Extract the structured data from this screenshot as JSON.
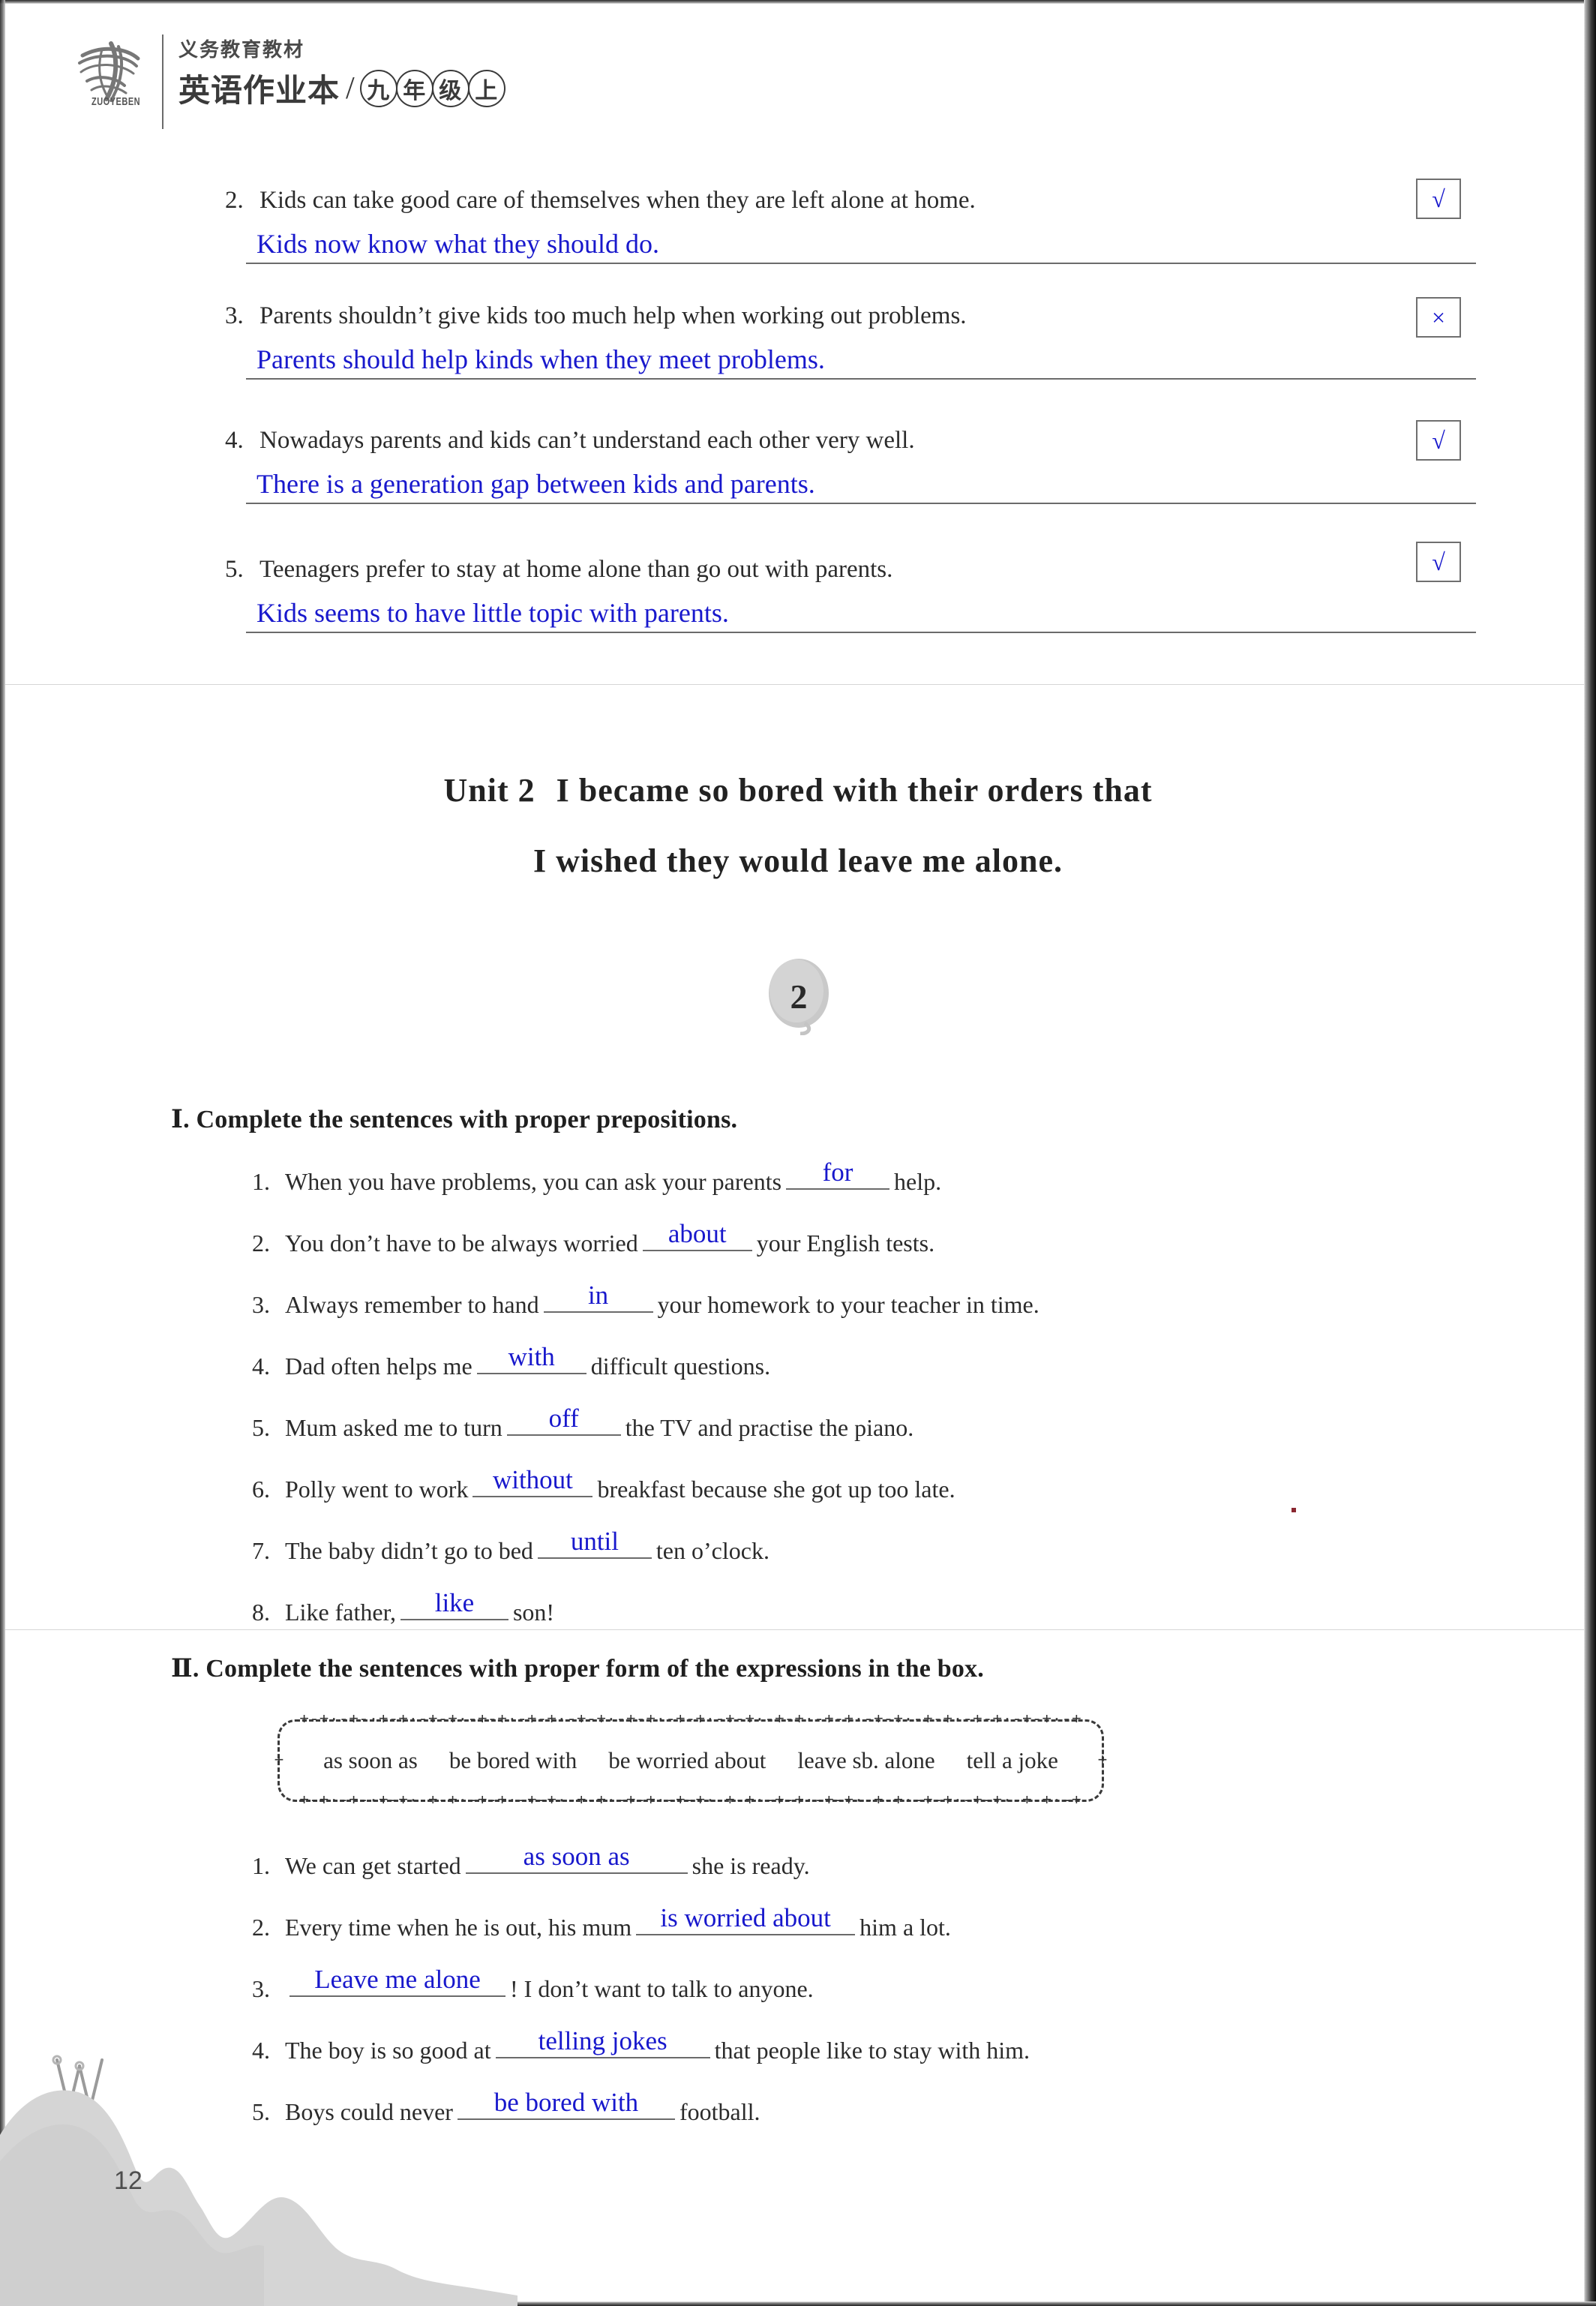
{
  "header": {
    "logo_caption": "ZUOYEBEN",
    "line1": "义务教育教材",
    "subject": "英语作业本",
    "slash": "/",
    "grade_chars": [
      "九",
      "年",
      "级",
      "上"
    ]
  },
  "true_false_section": {
    "items": [
      {
        "number": "2.",
        "statement": "Kids can take good care of themselves when they are left alone at home.",
        "mark": "√",
        "answer": "Kids now know what they should do."
      },
      {
        "number": "3.",
        "statement": "Parents shouldn’t give kids too much help when working out problems.",
        "mark": "×",
        "answer": "Parents should help kinds when they meet problems."
      },
      {
        "number": "4.",
        "statement": "Nowadays parents and kids can’t understand each other very well.",
        "mark": "√",
        "answer": "There is a generation gap between kids and parents."
      },
      {
        "number": "5.",
        "statement": "Teenagers prefer to stay at home alone than go out with parents.",
        "mark": "√",
        "answer": "Kids seems to have little topic with parents."
      }
    ]
  },
  "unit": {
    "title_line1_label": "Unit 2",
    "title_line1_rest": "I became so bored with their orders that",
    "title_line2": "I wished they would leave me alone.",
    "badge_number": "2"
  },
  "section_one": {
    "heading": "Ⅰ. Complete the sentences with proper prepositions.",
    "questions": [
      {
        "number": "1.",
        "before": "When you have problems, you can ask your parents",
        "answer": "for",
        "after": "help."
      },
      {
        "number": "2.",
        "before": "You don’t have to be always worried",
        "answer": "about",
        "after": "your English tests."
      },
      {
        "number": "3.",
        "before": "Always remember to hand",
        "answer": "in",
        "after": "your homework to your teacher in time."
      },
      {
        "number": "4.",
        "before": "Dad often helps me",
        "answer": "with",
        "after": "difficult questions."
      },
      {
        "number": "5.",
        "before": "Mum asked me to turn",
        "answer": "off",
        "after": "the TV and practise the piano."
      },
      {
        "number": "6.",
        "before": "Polly went to work",
        "answer": "without",
        "after": "breakfast because she got up too late."
      },
      {
        "number": "7.",
        "before": "The baby didn’t go to bed",
        "answer": "until",
        "after": "ten o’clock."
      },
      {
        "number": "8.",
        "before": "Like father,",
        "answer": "like",
        "after": "son!"
      }
    ]
  },
  "section_two": {
    "heading": "Ⅱ. Complete the sentences with proper form of the expressions in the box.",
    "word_box": [
      "as soon as",
      "be bored with",
      "be worried about",
      "leave sb. alone",
      "tell a joke"
    ],
    "questions": [
      {
        "number": "1.",
        "before": "We can get started",
        "answer": "as soon as",
        "after": "she is ready."
      },
      {
        "number": "2.",
        "before": "Every time when he is out, his mum",
        "answer": "is worried about",
        "after": "him a lot."
      },
      {
        "number": "3.",
        "before": "",
        "answer": "Leave me alone",
        "after": "! I don’t want to talk to anyone."
      },
      {
        "number": "4.",
        "before": "The boy is so good at",
        "answer": "telling jokes",
        "after": "that people like to stay with him."
      },
      {
        "number": "5.",
        "before": "Boys could never",
        "answer": "be bored with",
        "after": "football."
      }
    ]
  },
  "footer": {
    "page_number": "12"
  },
  "colors": {
    "ink_blue": "#1818cc",
    "print_black": "#2b2b2b",
    "rule_gray": "#6b6b6b",
    "watermark_gray": "#d2d2d2"
  }
}
